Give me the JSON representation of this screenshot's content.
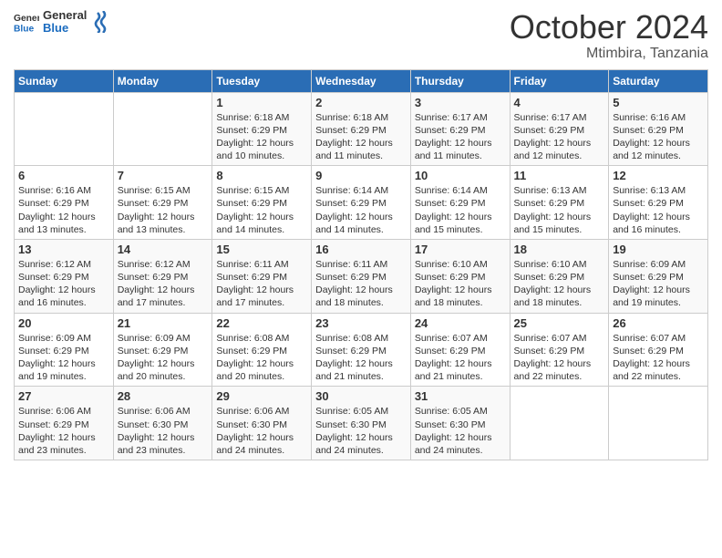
{
  "logo": {
    "general": "General",
    "blue": "Blue"
  },
  "header": {
    "month": "October 2024",
    "location": "Mtimbira, Tanzania"
  },
  "weekdays": [
    "Sunday",
    "Monday",
    "Tuesday",
    "Wednesday",
    "Thursday",
    "Friday",
    "Saturday"
  ],
  "weeks": [
    [
      {
        "day": null,
        "info": null
      },
      {
        "day": null,
        "info": null
      },
      {
        "day": "1",
        "sunrise": "Sunrise: 6:18 AM",
        "sunset": "Sunset: 6:29 PM",
        "daylight": "Daylight: 12 hours and 10 minutes."
      },
      {
        "day": "2",
        "sunrise": "Sunrise: 6:18 AM",
        "sunset": "Sunset: 6:29 PM",
        "daylight": "Daylight: 12 hours and 11 minutes."
      },
      {
        "day": "3",
        "sunrise": "Sunrise: 6:17 AM",
        "sunset": "Sunset: 6:29 PM",
        "daylight": "Daylight: 12 hours and 11 minutes."
      },
      {
        "day": "4",
        "sunrise": "Sunrise: 6:17 AM",
        "sunset": "Sunset: 6:29 PM",
        "daylight": "Daylight: 12 hours and 12 minutes."
      },
      {
        "day": "5",
        "sunrise": "Sunrise: 6:16 AM",
        "sunset": "Sunset: 6:29 PM",
        "daylight": "Daylight: 12 hours and 12 minutes."
      }
    ],
    [
      {
        "day": "6",
        "sunrise": "Sunrise: 6:16 AM",
        "sunset": "Sunset: 6:29 PM",
        "daylight": "Daylight: 12 hours and 13 minutes."
      },
      {
        "day": "7",
        "sunrise": "Sunrise: 6:15 AM",
        "sunset": "Sunset: 6:29 PM",
        "daylight": "Daylight: 12 hours and 13 minutes."
      },
      {
        "day": "8",
        "sunrise": "Sunrise: 6:15 AM",
        "sunset": "Sunset: 6:29 PM",
        "daylight": "Daylight: 12 hours and 14 minutes."
      },
      {
        "day": "9",
        "sunrise": "Sunrise: 6:14 AM",
        "sunset": "Sunset: 6:29 PM",
        "daylight": "Daylight: 12 hours and 14 minutes."
      },
      {
        "day": "10",
        "sunrise": "Sunrise: 6:14 AM",
        "sunset": "Sunset: 6:29 PM",
        "daylight": "Daylight: 12 hours and 15 minutes."
      },
      {
        "day": "11",
        "sunrise": "Sunrise: 6:13 AM",
        "sunset": "Sunset: 6:29 PM",
        "daylight": "Daylight: 12 hours and 15 minutes."
      },
      {
        "day": "12",
        "sunrise": "Sunrise: 6:13 AM",
        "sunset": "Sunset: 6:29 PM",
        "daylight": "Daylight: 12 hours and 16 minutes."
      }
    ],
    [
      {
        "day": "13",
        "sunrise": "Sunrise: 6:12 AM",
        "sunset": "Sunset: 6:29 PM",
        "daylight": "Daylight: 12 hours and 16 minutes."
      },
      {
        "day": "14",
        "sunrise": "Sunrise: 6:12 AM",
        "sunset": "Sunset: 6:29 PM",
        "daylight": "Daylight: 12 hours and 17 minutes."
      },
      {
        "day": "15",
        "sunrise": "Sunrise: 6:11 AM",
        "sunset": "Sunset: 6:29 PM",
        "daylight": "Daylight: 12 hours and 17 minutes."
      },
      {
        "day": "16",
        "sunrise": "Sunrise: 6:11 AM",
        "sunset": "Sunset: 6:29 PM",
        "daylight": "Daylight: 12 hours and 18 minutes."
      },
      {
        "day": "17",
        "sunrise": "Sunrise: 6:10 AM",
        "sunset": "Sunset: 6:29 PM",
        "daylight": "Daylight: 12 hours and 18 minutes."
      },
      {
        "day": "18",
        "sunrise": "Sunrise: 6:10 AM",
        "sunset": "Sunset: 6:29 PM",
        "daylight": "Daylight: 12 hours and 18 minutes."
      },
      {
        "day": "19",
        "sunrise": "Sunrise: 6:09 AM",
        "sunset": "Sunset: 6:29 PM",
        "daylight": "Daylight: 12 hours and 19 minutes."
      }
    ],
    [
      {
        "day": "20",
        "sunrise": "Sunrise: 6:09 AM",
        "sunset": "Sunset: 6:29 PM",
        "daylight": "Daylight: 12 hours and 19 minutes."
      },
      {
        "day": "21",
        "sunrise": "Sunrise: 6:09 AM",
        "sunset": "Sunset: 6:29 PM",
        "daylight": "Daylight: 12 hours and 20 minutes."
      },
      {
        "day": "22",
        "sunrise": "Sunrise: 6:08 AM",
        "sunset": "Sunset: 6:29 PM",
        "daylight": "Daylight: 12 hours and 20 minutes."
      },
      {
        "day": "23",
        "sunrise": "Sunrise: 6:08 AM",
        "sunset": "Sunset: 6:29 PM",
        "daylight": "Daylight: 12 hours and 21 minutes."
      },
      {
        "day": "24",
        "sunrise": "Sunrise: 6:07 AM",
        "sunset": "Sunset: 6:29 PM",
        "daylight": "Daylight: 12 hours and 21 minutes."
      },
      {
        "day": "25",
        "sunrise": "Sunrise: 6:07 AM",
        "sunset": "Sunset: 6:29 PM",
        "daylight": "Daylight: 12 hours and 22 minutes."
      },
      {
        "day": "26",
        "sunrise": "Sunrise: 6:07 AM",
        "sunset": "Sunset: 6:29 PM",
        "daylight": "Daylight: 12 hours and 22 minutes."
      }
    ],
    [
      {
        "day": "27",
        "sunrise": "Sunrise: 6:06 AM",
        "sunset": "Sunset: 6:29 PM",
        "daylight": "Daylight: 12 hours and 23 minutes."
      },
      {
        "day": "28",
        "sunrise": "Sunrise: 6:06 AM",
        "sunset": "Sunset: 6:30 PM",
        "daylight": "Daylight: 12 hours and 23 minutes."
      },
      {
        "day": "29",
        "sunrise": "Sunrise: 6:06 AM",
        "sunset": "Sunset: 6:30 PM",
        "daylight": "Daylight: 12 hours and 24 minutes."
      },
      {
        "day": "30",
        "sunrise": "Sunrise: 6:05 AM",
        "sunset": "Sunset: 6:30 PM",
        "daylight": "Daylight: 12 hours and 24 minutes."
      },
      {
        "day": "31",
        "sunrise": "Sunrise: 6:05 AM",
        "sunset": "Sunset: 6:30 PM",
        "daylight": "Daylight: 12 hours and 24 minutes."
      },
      {
        "day": null,
        "info": null
      },
      {
        "day": null,
        "info": null
      }
    ]
  ]
}
